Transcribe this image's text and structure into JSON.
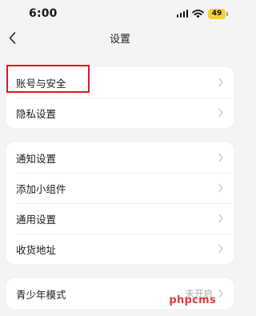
{
  "status_bar": {
    "time": "6:00",
    "battery": "49",
    "icons": [
      "signal-icon",
      "wifi-icon",
      "battery-icon"
    ]
  },
  "nav": {
    "title": "设置",
    "back_icon": "back-chevron-icon"
  },
  "groups": [
    {
      "items": [
        {
          "label": "账号与安全",
          "highlighted": true
        },
        {
          "label": "隐私设置"
        }
      ]
    },
    {
      "items": [
        {
          "label": "通知设置"
        },
        {
          "label": "添加小组件"
        },
        {
          "label": "通用设置"
        },
        {
          "label": "收货地址"
        }
      ]
    },
    {
      "items": [
        {
          "label": "青少年模式",
          "value": "未开启"
        }
      ]
    }
  ],
  "watermark": "phpcms",
  "colors": {
    "background": "#f4f4f6",
    "card": "#ffffff",
    "highlight": "#e4141e",
    "battery": "#f5d132",
    "watermark": "#e23a3a"
  }
}
